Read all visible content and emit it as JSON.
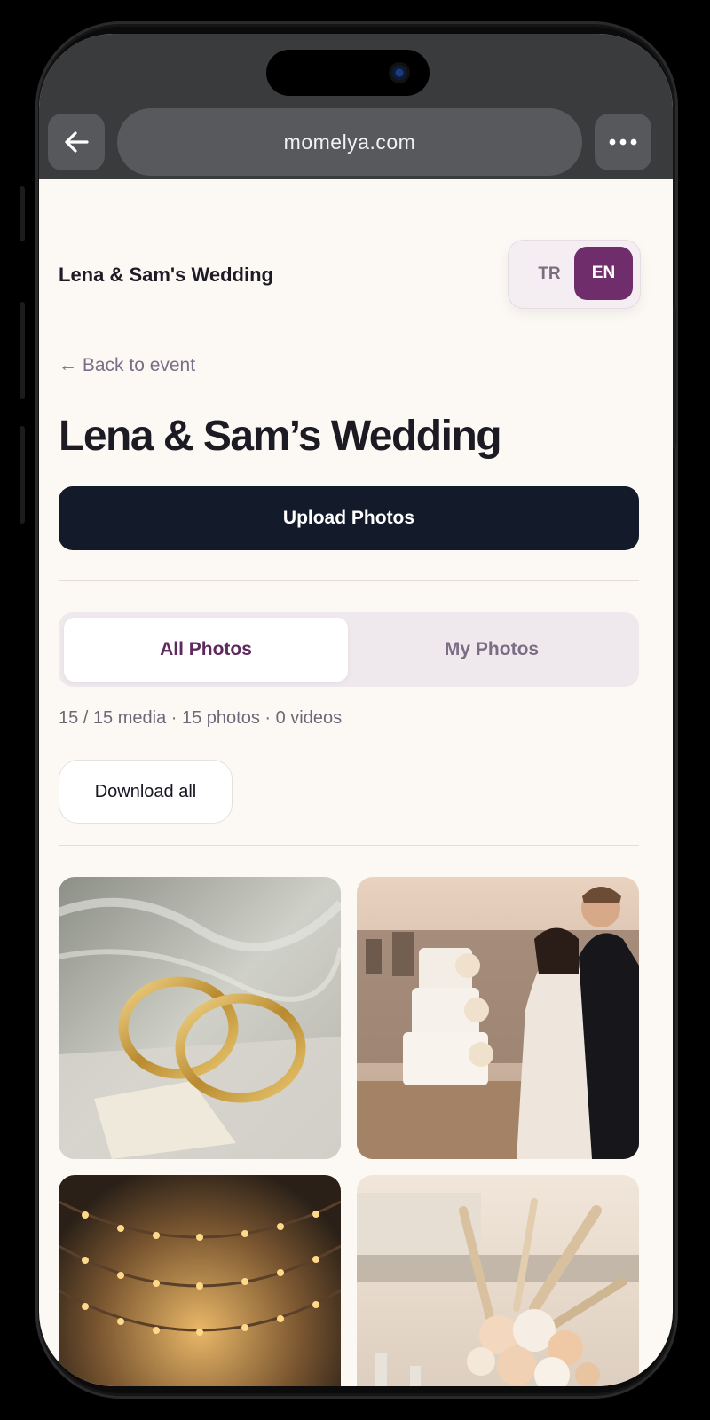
{
  "browser": {
    "url": "momelya.com"
  },
  "header": {
    "site_title": "Lena & Sam's Wedding",
    "lang_options": [
      "TR",
      "EN"
    ],
    "lang_active": "EN"
  },
  "page": {
    "back_link": "← Back to event",
    "title": "Lena & Sam’s Wedding",
    "upload_label": "Upload Photos",
    "tabs": [
      {
        "label": "All Photos",
        "active": true
      },
      {
        "label": "My Photos",
        "active": false
      }
    ],
    "count_text": "15 / 15 media · 15 photos · 0 videos",
    "download_label": "Download all"
  },
  "colors": {
    "accent": "#6f2e6b",
    "primary_button": "#131a29",
    "background": "#fcf9f4"
  },
  "photos": [
    {
      "subject": "wedding rings"
    },
    {
      "subject": "couple cutting cake"
    },
    {
      "subject": "string lights reception"
    },
    {
      "subject": "floral table centerpiece"
    }
  ]
}
